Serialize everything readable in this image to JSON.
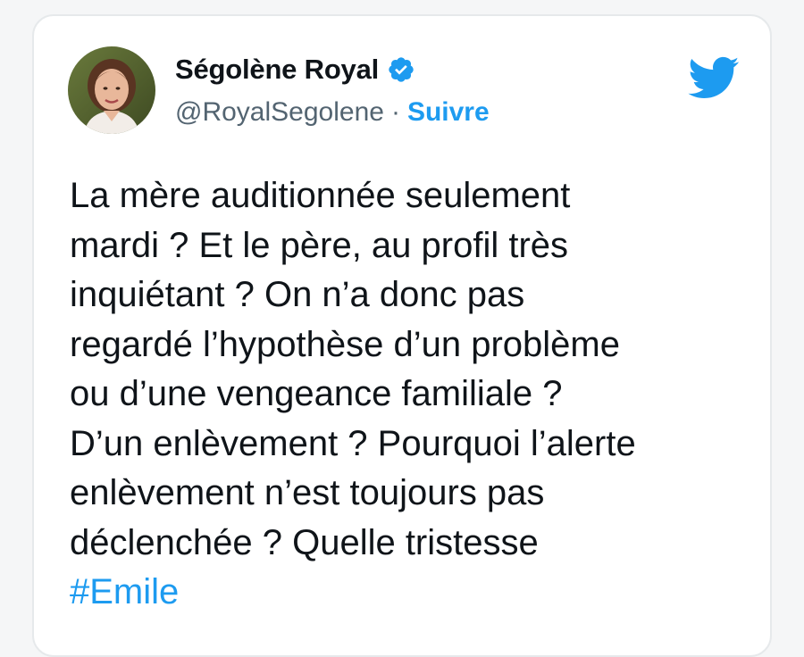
{
  "tweet": {
    "author_name": "Ségolène Royal",
    "author_handle": "@RoyalSegolene",
    "separator": "·",
    "follow_label": "Suivre",
    "text_lines": [
      "La mère auditionnée seulement",
      "mardi ? Et le père, au profil très",
      "inquiétant ? On n’a donc pas",
      "regardé l’hypothèse d’un problème",
      "ou d’une vengeance familiale ?",
      "D’un enlèvement ? Pourquoi l’alerte",
      "enlèvement n’est toujours pas",
      "déclenchée ? Quelle tristesse"
    ],
    "hashtag": "#Emile"
  },
  "icons": {
    "verified": "verified-badge-icon",
    "brand": "twitter-bird-icon"
  },
  "colors": {
    "accent": "#1d9bf0",
    "text": "#0f1419",
    "secondary_text": "#536471",
    "card_border": "#e6e9eb"
  }
}
